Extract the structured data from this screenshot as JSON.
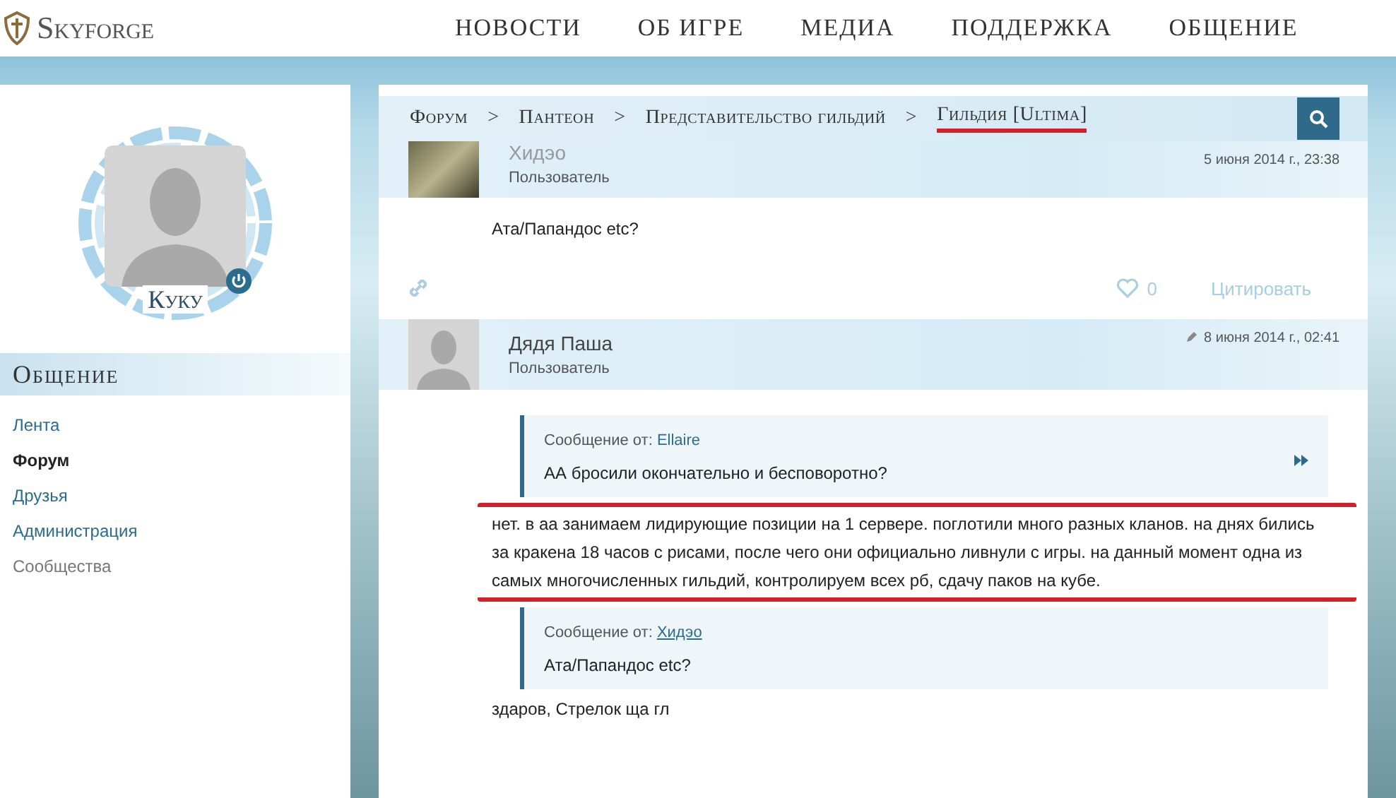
{
  "header": {
    "logo": "Skyforge",
    "nav": [
      {
        "label": "НОВОСТИ",
        "selected": false
      },
      {
        "label": "ОБ ИГРЕ",
        "selected": false
      },
      {
        "label": "МЕДИА",
        "selected": false
      },
      {
        "label": "ПОДДЕРЖКА",
        "selected": false
      },
      {
        "label": "ОБЩЕНИЕ",
        "selected": false
      }
    ]
  },
  "profile": {
    "name": "Куку",
    "online": true
  },
  "sidebar": {
    "title": "Общение",
    "items": [
      {
        "label": "Лента",
        "selected": false,
        "disabled": false
      },
      {
        "label": "Форум",
        "selected": true,
        "disabled": false
      },
      {
        "label": "Друзья",
        "selected": false,
        "disabled": false
      },
      {
        "label": "Администрация",
        "selected": false,
        "disabled": false
      },
      {
        "label": "Сообщества",
        "selected": false,
        "disabled": true
      }
    ]
  },
  "breadcrumbs": [
    {
      "label": "Форум",
      "underlined": false
    },
    {
      "label": "Пантеон",
      "underlined": false
    },
    {
      "label": "Представительство гильдий",
      "underlined": false
    },
    {
      "label": "Гильдия [Ultima]",
      "underlined": true
    }
  ],
  "breadcrumb_separator": ">",
  "posts": [
    {
      "author": "Хидэо",
      "role": "Пользователь",
      "date": "5 июня 2014 г., 23:38",
      "avatar": {
        "kind": "photo"
      },
      "blocks": [
        {
          "kind": "text",
          "text": "Ата/Папандос etc?"
        }
      ],
      "likes": "0",
      "quote_action": "Цитировать"
    },
    {
      "author": "Дядя Паша",
      "role": "Пользователь",
      "date": "8 июня 2014 г., 02:41",
      "edited": true,
      "avatar": {
        "kind": "silhouette"
      },
      "blocks": [
        {
          "kind": "quote",
          "label": "Сообщение от:",
          "source": "Ellaire",
          "link": false,
          "text": "АА бросили окончательно и бесповоротно?",
          "expand": true
        },
        {
          "kind": "text",
          "text": "нет. в аа занимаем лидирующие позиции на 1 сервере. поглотили много разных кланов. на днях бились за кракена 18 часов с рисами, после чего они официально ливнули с игры. на данный момент одна из самых многочисленных гильдий, контролируем всех рб, сдачу паков на кубе.",
          "underlined": true
        },
        {
          "kind": "quote",
          "label": "Сообщение от:",
          "source": "Хидэо",
          "link": true,
          "text": "Ата/Папандос etc?",
          "expand": false
        },
        {
          "kind": "text",
          "text": "здаров, Стрелок ща гл"
        }
      ]
    }
  ]
}
